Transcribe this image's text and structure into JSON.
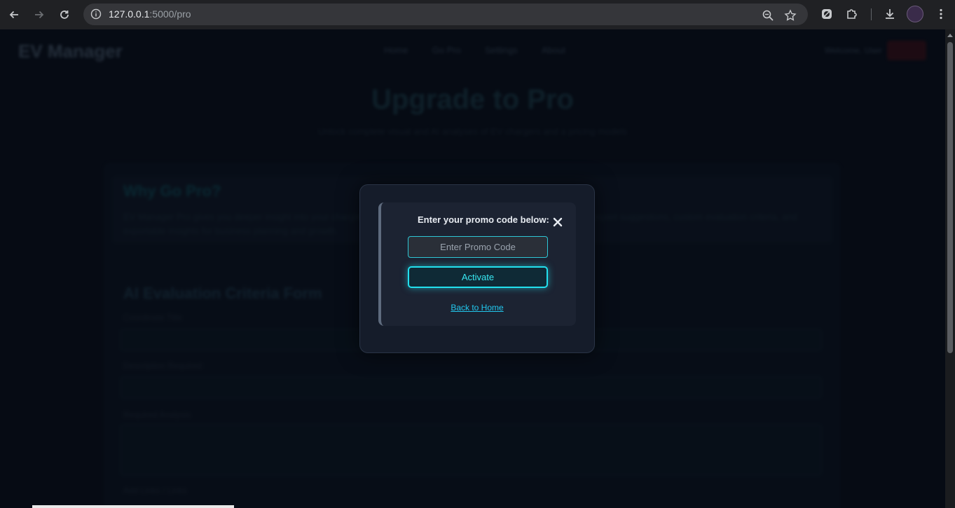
{
  "browser": {
    "url_host": "127.0.0.1",
    "url_path": ":5000/pro"
  },
  "page": {
    "brand": "EV Manager",
    "nav": [
      "Home",
      "Go Pro",
      "Settings",
      "About"
    ],
    "welcome": "Welcome, User",
    "hero_title": "Upgrade to Pro",
    "hero_subtitle": "Unlock complete visual and AI analyses of EV chargers and a pricing models",
    "why_title": "Why Go Pro?",
    "why_text": "EV Manager Pro gives you deeper insight into your charging network with priority analytics, AI-powered reports, and expert suggestions, custom evaluation criteria, and exportable insights for business planning and growth.",
    "form_title": "AI Evaluation Criteria Form",
    "labels": [
      "Coordinate Title",
      "Description Required",
      "Required Analysis",
      "Add Links / Links"
    ]
  },
  "modal": {
    "message": "Enter your promo code below:",
    "input_placeholder": "Enter Promo Code",
    "activate_label": "Activate",
    "back_link": "Back to Home"
  },
  "colors": {
    "accent": "#22e0ee",
    "modal_bg": "#151c2a",
    "page_bg": "#060b14"
  }
}
